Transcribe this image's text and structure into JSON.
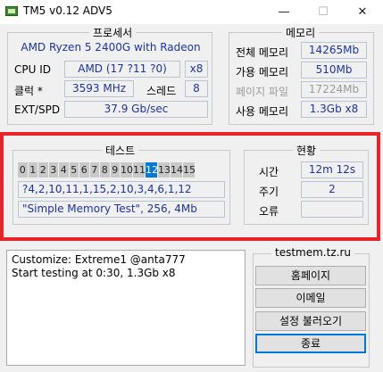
{
  "window": {
    "title": "TM5 v0.12 ADV5",
    "minimize": "—",
    "maximize": "☐",
    "close": "✕"
  },
  "processor": {
    "group_label": "프로세서",
    "name": "AMD Ryzen 5 2400G with Radeon",
    "cpuid_label": "CPU ID",
    "cpuid_value": "AMD  (17 ?11 ?0)",
    "cpuid_count": "x8",
    "clock_label": "클럭 *",
    "clock_value": "3593 MHz",
    "threads_label": "스레드",
    "threads_value": "8",
    "ext_label": "EXT/SPD",
    "ext_value": "37.9 Gb/sec"
  },
  "memory": {
    "group_label": "메모리",
    "total_label": "전체 메모리",
    "total_value": "14265Mb",
    "avail_label": "가용 메모리",
    "avail_value": "510Mb",
    "page_label": "페이지 파일",
    "page_value": "17224Mb",
    "used_label": "사용 메모리",
    "used_value": "1.3Gb x8"
  },
  "test": {
    "group_label": "테스트",
    "cells": [
      "0",
      "1",
      "2",
      "3",
      "4",
      "5",
      "6",
      "7",
      "8",
      "9",
      "10",
      "11",
      "12",
      "13",
      "14",
      "15"
    ],
    "active_cell": 12,
    "sequence": "?4,2,10,11,1,15,2,10,3,4,6,1,12",
    "config": "\"Simple Memory Test\", 256, 4Mb"
  },
  "status": {
    "group_label": "현황",
    "time_label": "시간",
    "time_value": "12m 12s",
    "cycle_label": "주기",
    "cycle_value": "2",
    "error_label": "오류",
    "error_value": ""
  },
  "log": {
    "lines": [
      "Customize: Extreme1 @anta777",
      "Start testing at 0:30, 1.3Gb x8"
    ]
  },
  "links": {
    "site": "testmem.tz.ru",
    "homepage": "홈페이지",
    "email": "이메일",
    "load_settings": "설정 불러오기",
    "exit": "종료"
  },
  "colors": {
    "highlight": "#e8242a",
    "value_text": "#1a33a6",
    "active_cell": "#0078d7"
  }
}
